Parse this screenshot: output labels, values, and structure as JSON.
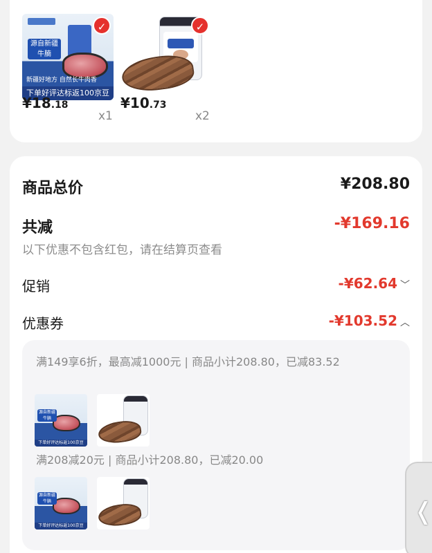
{
  "products": [
    {
      "price_int": "¥18",
      "price_dec": ".18",
      "qty": "x1",
      "banner": "下单好评达标返100京豆",
      "tag": "源自新疆 牛腩",
      "sub": "新疆好地方 自然长牛肉香",
      "icon": "check-icon"
    },
    {
      "price_int": "¥10",
      "price_dec": ".73",
      "qty": "x2",
      "icon": "check-icon"
    }
  ],
  "summary": {
    "total_label": "商品总价",
    "total_value": "¥208.80",
    "discount_label": "共减",
    "discount_value": "-¥169.16",
    "note": "以下优惠不包含红包，请在结算页查看",
    "promo_label": "促销",
    "promo_value": "-¥62.64",
    "coupon_label": "优惠券",
    "coupon_value": "-¥103.52"
  },
  "coupon_rules": [
    {
      "text": "满149享6折，最高减1000元 | 商品小计208.80，已减83.52"
    },
    {
      "text": "满208减20元 | 商品小计208.80，已减20.00"
    }
  ],
  "colors": {
    "accent": "#e2392d",
    "check": "#e5312d"
  },
  "icons": {
    "collapse": "chevron-up-icon",
    "expand": "chevron-down-icon",
    "side": "chevron-left-icon"
  }
}
